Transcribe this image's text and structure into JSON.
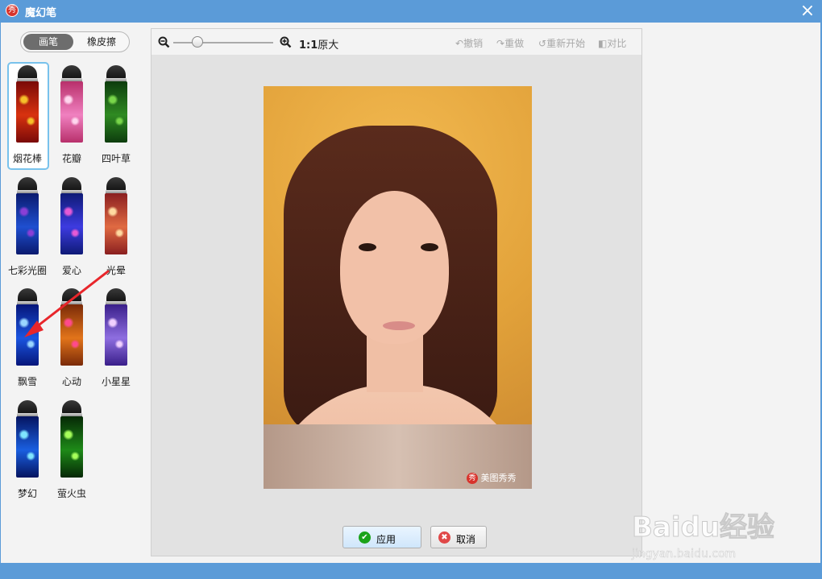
{
  "window": {
    "title": "魔幻笔",
    "app_icon_glyph": "秀",
    "close_glyph": "×"
  },
  "mode_toggle": {
    "brush_label": "画笔",
    "eraser_label": "橡皮擦",
    "active": "画笔"
  },
  "brushes": [
    {
      "label": "烟花棒",
      "selected": true,
      "colors": [
        "#7a0a08",
        "#d8320f",
        "#f6c02a"
      ]
    },
    {
      "label": "花瓣",
      "selected": false,
      "colors": [
        "#b8306b",
        "#f080c0",
        "#ffd6ee"
      ]
    },
    {
      "label": "四叶草",
      "selected": false,
      "colors": [
        "#0d3c0d",
        "#2f8a22",
        "#79d64a"
      ]
    },
    {
      "label": "七彩光圈",
      "selected": false,
      "colors": [
        "#0a1a6e",
        "#1f4fd0",
        "#8a3fd6"
      ]
    },
    {
      "label": "爱心",
      "selected": false,
      "colors": [
        "#0e1a76",
        "#3d3be0",
        "#e55ad6"
      ]
    },
    {
      "label": "光晕",
      "selected": false,
      "colors": [
        "#8a1f20",
        "#e06a42",
        "#ffd9a0"
      ]
    },
    {
      "label": "飘雪",
      "selected": false,
      "colors": [
        "#06167a",
        "#1a55e0",
        "#9ad6ff"
      ]
    },
    {
      "label": "心动",
      "selected": false,
      "colors": [
        "#7a2a08",
        "#e2741a",
        "#ff4a8c"
      ]
    },
    {
      "label": "小星星",
      "selected": false,
      "colors": [
        "#3a1f8a",
        "#8e6ee0",
        "#f0d0ff"
      ]
    },
    {
      "label": "梦幻",
      "selected": false,
      "colors": [
        "#051460",
        "#1a5fe0",
        "#7fe6ff"
      ]
    },
    {
      "label": "萤火虫",
      "selected": false,
      "colors": [
        "#062806",
        "#1e8a18",
        "#a6ff5a"
      ]
    }
  ],
  "toolbar": {
    "zoom_out_icon": "zoom-out-icon",
    "zoom_in_icon": "zoom-in-icon",
    "zoom_ratio_label": "1:1",
    "original_size_label": "原大",
    "undo_label": "撤销",
    "redo_label": "重做",
    "restart_label": "重新开始",
    "compare_label": "对比"
  },
  "photo": {
    "watermark_icon": "秀",
    "watermark_text": "美图秀秀"
  },
  "buttons": {
    "apply_label": "应用",
    "cancel_label": "取消"
  },
  "overlay": {
    "watermark_text": "Baidu经验",
    "watermark_url": "jingyan.baidu.com"
  },
  "colors": {
    "titlebar": "#5b9bd8",
    "selected_border": "#78c2ec",
    "arrow": "#e8262b"
  }
}
